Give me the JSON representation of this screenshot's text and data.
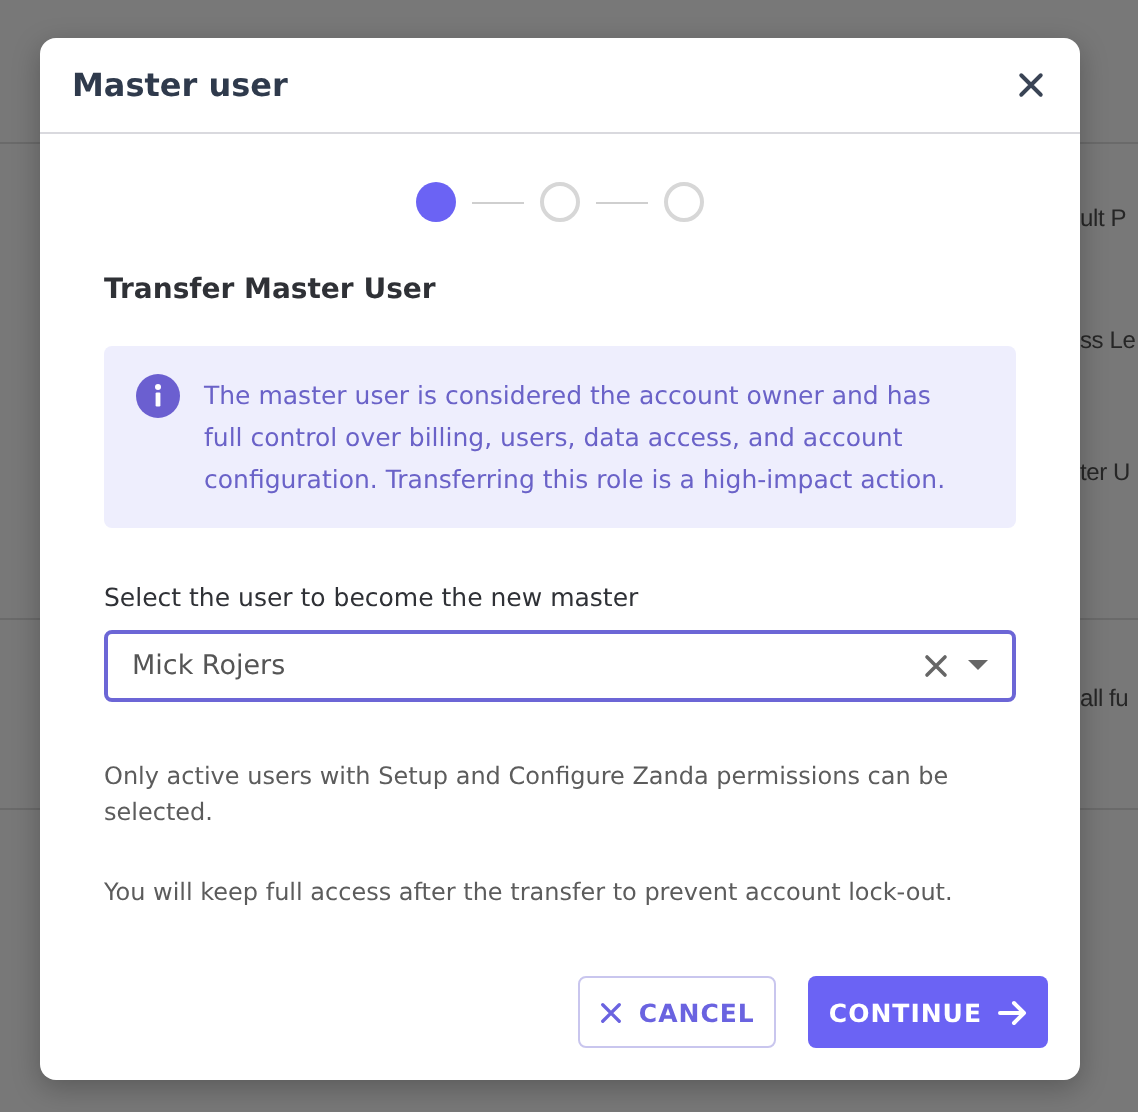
{
  "background": {
    "texts": [
      "ult P",
      "ss Le",
      "ter U",
      "all fu"
    ]
  },
  "dialog": {
    "title": "Master user",
    "steps": [
      {
        "selected": true
      },
      {
        "selected": false
      },
      {
        "selected": false
      }
    ],
    "section_title": "Transfer Master User",
    "info": "The master user is considered the account owner and has full control over billing, users, data access, and account configuration. Transferring this role is a high-impact action.",
    "field": {
      "label": "Select the user to become the new master",
      "value": "Mick Rojers"
    },
    "notes": [
      "Only active users with Setup and Configure Zanda permissions can be selected.",
      "You will keep full access after the transfer to prevent account lock-out."
    ],
    "buttons": [
      {
        "kind": "cancel",
        "label": "CANCEL"
      },
      {
        "kind": "continue",
        "label": "CONTINUE"
      }
    ]
  }
}
